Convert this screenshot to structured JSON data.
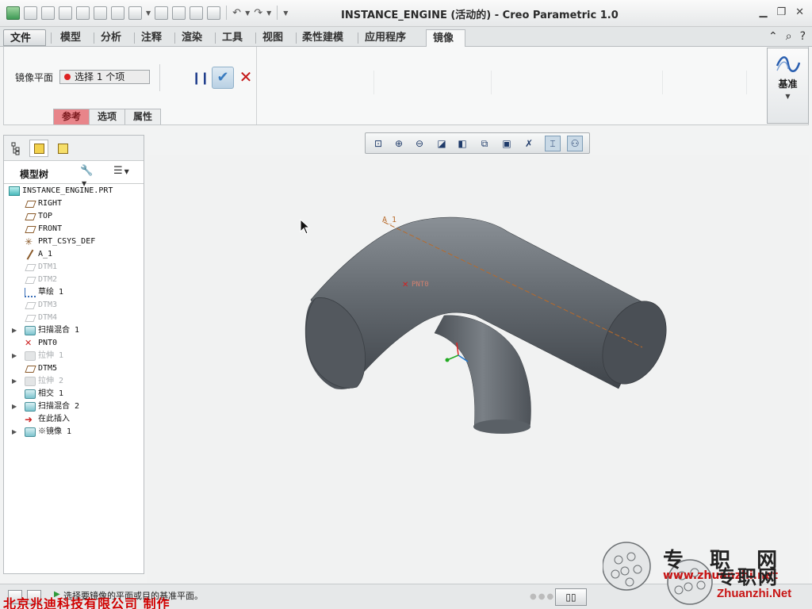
{
  "window": {
    "title": "INSTANCE_ENGINE (活动的) - Creo Parametric 1.0"
  },
  "ribbon": {
    "file_label": "文件",
    "tabs": [
      "模型",
      "分析",
      "注释",
      "渲染",
      "工具",
      "视图",
      "柔性建模",
      "应用程序"
    ],
    "active_tab": "镜像"
  },
  "mirror": {
    "plane_label": "镜像平面",
    "collector_text": "选择 1 个项",
    "subtabs": [
      "参考",
      "选项",
      "属性"
    ]
  },
  "datum": {
    "label": "基准"
  },
  "model_tree": {
    "title": "模型树",
    "root": "INSTANCE_ENGINE.PRT",
    "items": [
      {
        "label": "RIGHT",
        "icon": "datum-plane-icon",
        "dim": false,
        "expandable": false
      },
      {
        "label": "TOP",
        "icon": "datum-plane-icon",
        "dim": false,
        "expandable": false
      },
      {
        "label": "FRONT",
        "icon": "datum-plane-icon",
        "dim": false,
        "expandable": false
      },
      {
        "label": "PRT_CSYS_DEF",
        "icon": "csys-icon",
        "dim": false,
        "expandable": false
      },
      {
        "label": "A_1",
        "icon": "datum-axis-icon",
        "dim": false,
        "expandable": false
      },
      {
        "label": "DTM1",
        "icon": "datum-plane-icon",
        "dim": true,
        "expandable": false
      },
      {
        "label": "DTM2",
        "icon": "datum-plane-icon",
        "dim": true,
        "expandable": false
      },
      {
        "label": "草绘 1",
        "icon": "sketch-icon",
        "dim": false,
        "expandable": false
      },
      {
        "label": "DTM3",
        "icon": "datum-plane-icon",
        "dim": true,
        "expandable": false
      },
      {
        "label": "DTM4",
        "icon": "datum-plane-icon",
        "dim": true,
        "expandable": false
      },
      {
        "label": "扫描混合 1",
        "icon": "swept-blend-icon",
        "dim": false,
        "expandable": true
      },
      {
        "label": "PNT0",
        "icon": "datum-point-icon",
        "dim": false,
        "expandable": false
      },
      {
        "label": "拉伸 1",
        "icon": "extrude-icon",
        "dim": true,
        "expandable": true
      },
      {
        "label": "DTM5",
        "icon": "datum-plane-icon",
        "dim": false,
        "expandable": false
      },
      {
        "label": "拉伸 2",
        "icon": "extrude-icon",
        "dim": true,
        "expandable": true
      },
      {
        "label": "相交 1",
        "icon": "intersect-icon",
        "dim": false,
        "expandable": false
      },
      {
        "label": "扫描混合 2",
        "icon": "swept-blend-icon",
        "dim": false,
        "expandable": true
      },
      {
        "label": "在此插入",
        "icon": "insert-here-icon",
        "dim": false,
        "expandable": false
      },
      {
        "label": "※镜像 1",
        "icon": "mirror-icon",
        "dim": false,
        "expandable": true
      }
    ]
  },
  "graphics": {
    "axis_label": "A_1",
    "point_label": "PNT0"
  },
  "status": {
    "message": "选择要镜像的平面或目的基准平面。",
    "credit": "北京兆迪科技有限公司  制作"
  },
  "watermark": {
    "site_cn": "专 职 网",
    "site_cn2": "专职网",
    "url1": "www.zhuanzhi.net",
    "url2": "Zhuanzhi.Net"
  },
  "colors": {
    "model_body": "#5d6369",
    "accent_blue": "#3a7cc0",
    "cancel_red": "#c41717",
    "reference_tab": "#e8858a"
  }
}
